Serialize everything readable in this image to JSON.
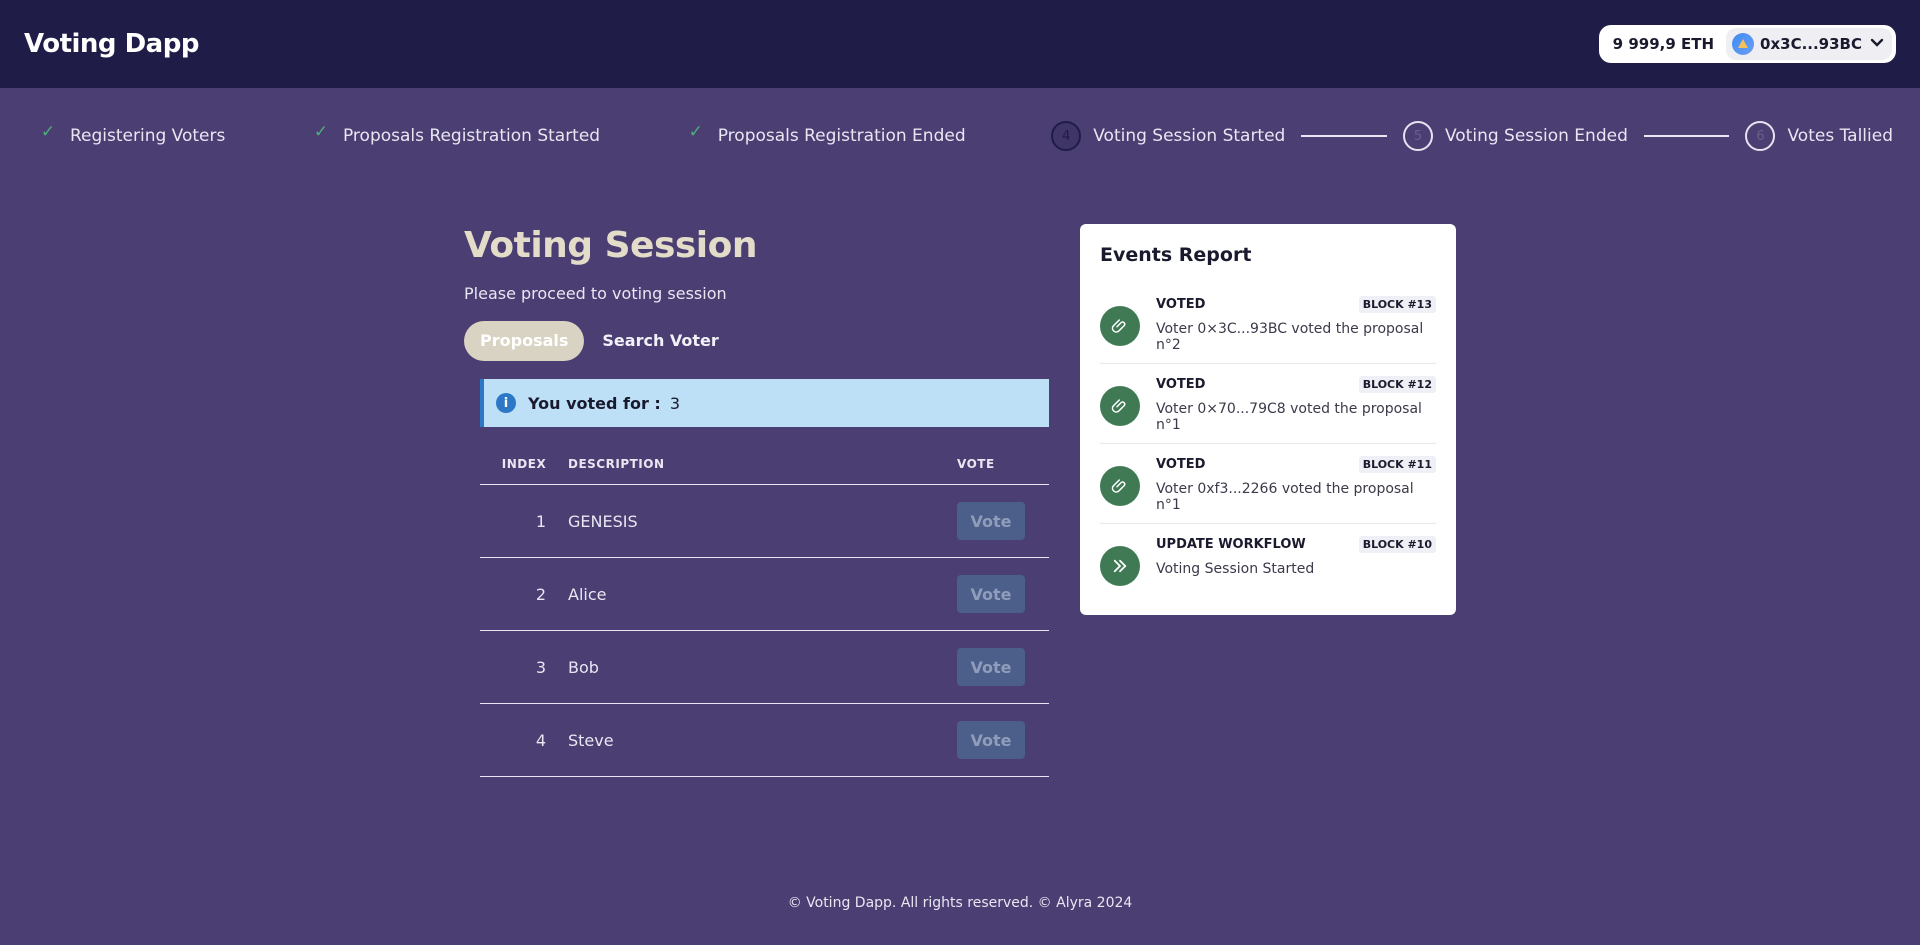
{
  "header": {
    "brand": "Voting Dapp",
    "balance": "9 999,9 ETH",
    "account": "0x3C...93BC"
  },
  "stepper": [
    {
      "label": "Registering Voters",
      "state": "done",
      "icon": "check-icon"
    },
    {
      "label": "Proposals Registration Started",
      "state": "done",
      "icon": "check-icon"
    },
    {
      "label": "Proposals Registration Ended",
      "state": "done",
      "icon": "check-icon"
    },
    {
      "label": "Voting Session Started",
      "state": "active",
      "number": "4"
    },
    {
      "label": "Voting Session Ended",
      "state": "pending",
      "number": "5"
    },
    {
      "label": "Votes Tallied",
      "state": "pending",
      "number": "6"
    }
  ],
  "main": {
    "title": "Voting Session",
    "subtitle": "Please proceed to voting session",
    "tabs": [
      {
        "label": "Proposals",
        "active": true
      },
      {
        "label": "Search Voter",
        "active": false
      }
    ],
    "alert": {
      "label": "You voted for :",
      "value": "3"
    },
    "table": {
      "headers": {
        "index": "INDEX",
        "description": "DESCRIPTION",
        "vote": "VOTE"
      },
      "rows": [
        {
          "index": "1",
          "description": "GENESIS",
          "vote": "Vote"
        },
        {
          "index": "2",
          "description": "Alice",
          "vote": "Vote"
        },
        {
          "index": "3",
          "description": "Bob",
          "vote": "Vote"
        },
        {
          "index": "4",
          "description": "Steve",
          "vote": "Vote"
        }
      ]
    }
  },
  "events": {
    "title": "Events Report",
    "items": [
      {
        "type": "VOTED",
        "block": "BLOCK #13",
        "desc": "Voter 0×3C...93BC voted the proposal n°2",
        "icon": "paperclip-icon"
      },
      {
        "type": "VOTED",
        "block": "BLOCK #12",
        "desc": "Voter 0×70...79C8 voted the proposal n°1",
        "icon": "paperclip-icon"
      },
      {
        "type": "VOTED",
        "block": "BLOCK #11",
        "desc": "Voter 0xf3...2266 voted the proposal n°1",
        "icon": "paperclip-icon"
      },
      {
        "type": "UPDATE WORKFLOW",
        "block": "BLOCK #10",
        "desc": "Voting Session Started",
        "icon": "double-chevron-right-icon"
      }
    ]
  },
  "footer": {
    "text": "© Voting Dapp. All rights reserved. © Alyra 2024"
  },
  "colors": {
    "background": "#4a3e72",
    "header": "#1f1d48",
    "accent_green": "#3f7a55",
    "alert_bg": "#bde0f7"
  }
}
